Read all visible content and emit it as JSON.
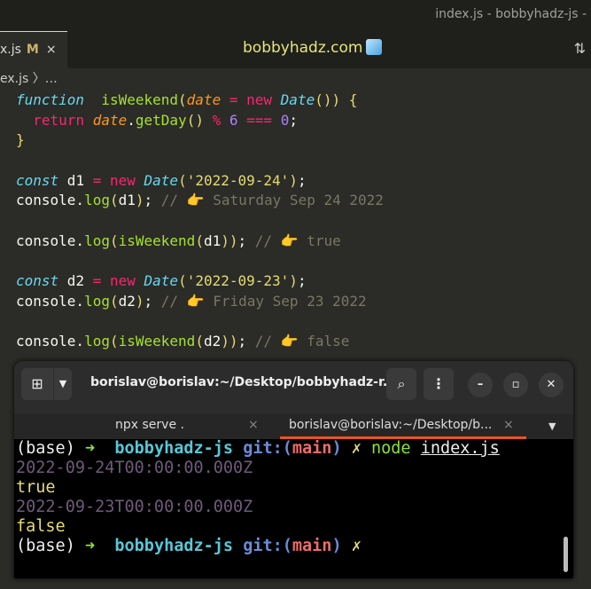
{
  "window_title": "index.js - bobbyhadz-js - Vis",
  "editor": {
    "tab": {
      "name": "x.js",
      "status": "M",
      "close": "×"
    },
    "brand": "bobbyhadz.com",
    "breadcrumb": "ex.js 〉…",
    "code": [
      [
        [
          "kw",
          "function"
        ],
        [
          "",
          "  "
        ],
        [
          "fn",
          "isWeekend"
        ],
        [
          "pa",
          "("
        ],
        [
          "pr",
          "date"
        ],
        [
          "",
          " "
        ],
        [
          "op",
          "="
        ],
        [
          "",
          " "
        ],
        [
          "op",
          "new"
        ],
        [
          "",
          " "
        ],
        [
          "kw",
          "Date"
        ],
        [
          "pa",
          "()) {"
        ]
      ],
      [
        [
          "",
          " "
        ],
        [
          "op",
          " return"
        ],
        [
          "",
          " "
        ],
        [
          "pr",
          "date"
        ],
        [
          "",
          "."
        ],
        [
          "fn",
          "getDay"
        ],
        [
          "pa",
          "()"
        ],
        [
          "",
          " "
        ],
        [
          "op",
          "%"
        ],
        [
          "",
          " "
        ],
        [
          "num",
          "6"
        ],
        [
          "",
          " "
        ],
        [
          "op",
          "==="
        ],
        [
          "",
          " "
        ],
        [
          "num",
          "0"
        ],
        [
          "",
          ";"
        ]
      ],
      [
        [
          "pa",
          "}"
        ]
      ],
      [
        [
          "",
          ""
        ]
      ],
      [
        [
          "kw",
          "const"
        ],
        [
          "",
          " d1 "
        ],
        [
          "op",
          "="
        ],
        [
          "",
          " "
        ],
        [
          "op",
          "new"
        ],
        [
          "",
          " "
        ],
        [
          "kw",
          "Date"
        ],
        [
          "pa",
          "("
        ],
        [
          "str",
          "'2022-09-24'"
        ],
        [
          "pa",
          ")"
        ],
        [
          "",
          ";"
        ]
      ],
      [
        [
          "",
          "console."
        ],
        [
          "fn",
          "log"
        ],
        [
          "pa",
          "("
        ],
        [
          "",
          "d1"
        ],
        [
          "pa",
          ")"
        ],
        [
          "",
          "; "
        ],
        [
          "cm",
          "// 👉 Saturday Sep 24 2022"
        ]
      ],
      [
        [
          "",
          ""
        ]
      ],
      [
        [
          "",
          "console."
        ],
        [
          "fn",
          "log"
        ],
        [
          "pa",
          "("
        ],
        [
          "fn",
          "isWeekend"
        ],
        [
          "pa",
          "("
        ],
        [
          "",
          "d1"
        ],
        [
          "pa",
          "))"
        ],
        [
          "",
          "; "
        ],
        [
          "cm",
          "// 👉 true"
        ]
      ],
      [
        [
          "",
          ""
        ]
      ],
      [
        [
          "kw",
          "const"
        ],
        [
          "",
          " d2 "
        ],
        [
          "op",
          "="
        ],
        [
          "",
          " "
        ],
        [
          "op",
          "new"
        ],
        [
          "",
          " "
        ],
        [
          "kw",
          "Date"
        ],
        [
          "pa",
          "("
        ],
        [
          "str",
          "'2022-09-23'"
        ],
        [
          "pa",
          ")"
        ],
        [
          "",
          ";"
        ]
      ],
      [
        [
          "",
          "console."
        ],
        [
          "fn",
          "log"
        ],
        [
          "pa",
          "("
        ],
        [
          "",
          "d2"
        ],
        [
          "pa",
          ")"
        ],
        [
          "",
          "; "
        ],
        [
          "cm",
          "// 👉 Friday Sep 23 2022"
        ]
      ],
      [
        [
          "",
          ""
        ]
      ],
      [
        [
          "",
          "console."
        ],
        [
          "fn",
          "log"
        ],
        [
          "pa",
          "("
        ],
        [
          "fn",
          "isWeekend"
        ],
        [
          "pa",
          "("
        ],
        [
          "",
          "d2"
        ],
        [
          "pa",
          "))"
        ],
        [
          "",
          "; "
        ],
        [
          "cm",
          "// 👉 false"
        ]
      ]
    ]
  },
  "terminal": {
    "title": "borislav@borislav:~/Desktop/bobbyhadz-r...",
    "tabs": [
      {
        "label": "npx serve .",
        "close": "×"
      },
      {
        "label": "borislav@borislav:~/Desktop/b...",
        "close": "×"
      }
    ],
    "lines": [
      [
        [
          "",
          "(base) "
        ],
        [
          "g",
          "➜  "
        ],
        [
          "c",
          "bobbyhadz-js "
        ],
        [
          "b",
          "git:("
        ],
        [
          "r",
          "main"
        ],
        [
          "b",
          ")"
        ],
        [
          "y",
          " ✗ "
        ],
        [
          "nd",
          "node "
        ],
        [
          "u",
          "index.js"
        ]
      ],
      [
        [
          "dm",
          "2022-09-24T00:00:00.000Z"
        ]
      ],
      [
        [
          "y",
          "true"
        ]
      ],
      [
        [
          "dm",
          "2022-09-23T00:00:00.000Z"
        ]
      ],
      [
        [
          "y",
          "false"
        ]
      ],
      [
        [
          "",
          "(base) "
        ],
        [
          "g",
          "➜  "
        ],
        [
          "c",
          "bobbyhadz-js "
        ],
        [
          "b",
          "git:("
        ],
        [
          "r",
          "main"
        ],
        [
          "b",
          ")"
        ],
        [
          "y",
          " ✗"
        ]
      ]
    ]
  }
}
